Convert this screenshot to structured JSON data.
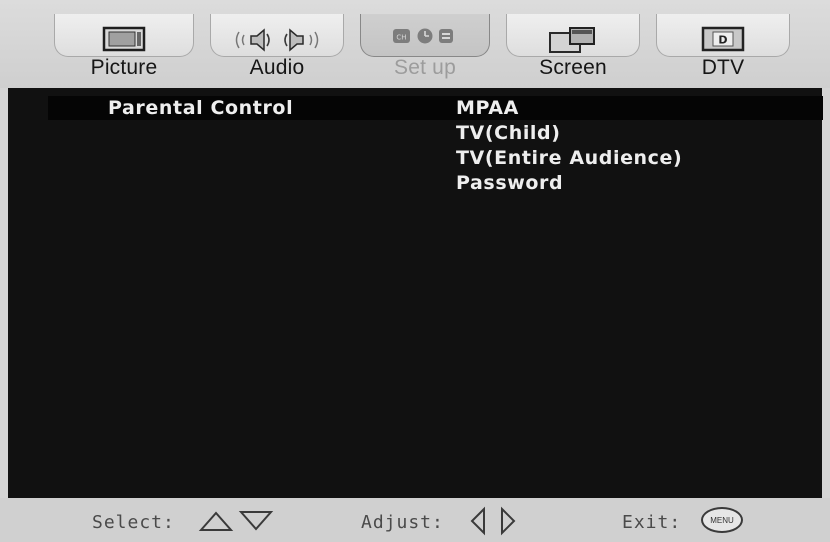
{
  "tabs": [
    {
      "label": "Picture",
      "icon": "monitor-icon",
      "active": false
    },
    {
      "label": "Audio",
      "icon": "speaker-icon",
      "active": false
    },
    {
      "label": "Set up",
      "icon": "setup-icons",
      "active": true
    },
    {
      "label": "Screen",
      "icon": "screen-windows-icon",
      "active": false
    },
    {
      "label": "DTV",
      "icon": "dtv-icon",
      "active": false
    }
  ],
  "dtv_icon_letter": "D",
  "menu": {
    "section_title": "Parental Control",
    "options": [
      "MPAA",
      "TV(Child)",
      "TV(Entire Audience)",
      "Password"
    ],
    "selected_option": "MPAA"
  },
  "help": {
    "select_label": "Select:",
    "adjust_label": "Adjust:",
    "exit_label": "Exit:",
    "exit_key": "MENU"
  },
  "colors": {
    "panel_bg": "#111111",
    "menu_text": "#eeeeee",
    "inactive_tab_label": "#9c9c9c",
    "chrome_bg": "#d4d4d4"
  }
}
